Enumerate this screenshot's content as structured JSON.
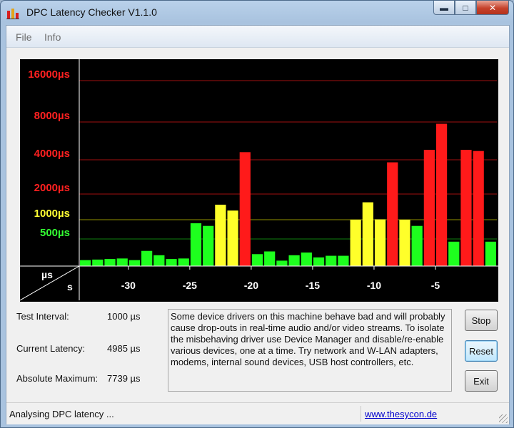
{
  "window": {
    "title": "DPC Latency Checker V1.1.0",
    "controls": {
      "minimize": "▬",
      "maximize": "□",
      "close": "✕"
    }
  },
  "menu": [
    {
      "label": "File"
    },
    {
      "label": "Info"
    }
  ],
  "chart_data": {
    "type": "bar",
    "x_unit_label": "s",
    "y_unit_label": "µs",
    "x_ticks": [
      -30,
      -25,
      -20,
      -15,
      -10,
      -5
    ],
    "x_range": [
      -34,
      0
    ],
    "y_levels": [
      {
        "label": "16000µs",
        "value": 16000,
        "color": "#ff2020",
        "grid_color": "#a01010"
      },
      {
        "label": "8000µs",
        "value": 8000,
        "color": "#ff2020",
        "grid_color": "#a01010"
      },
      {
        "label": "4000µs",
        "value": 4000,
        "color": "#ff2020",
        "grid_color": "#a01010"
      },
      {
        "label": "2000µs",
        "value": 2000,
        "color": "#ff2020",
        "grid_color": "#a01010"
      },
      {
        "label": "1000µs",
        "value": 1000,
        "color": "#ffff33",
        "grid_color": "#909000"
      },
      {
        "label": "500µs",
        "value": 500,
        "color": "#33ff33",
        "grid_color": "#108010"
      }
    ],
    "thresholds": {
      "yellow_from": 1000,
      "red_from": 2000
    },
    "colors": {
      "green": "#1eff1e",
      "yellow": "#ffff2a",
      "red": "#ff1a1a"
    },
    "values": [
      110,
      120,
      130,
      140,
      110,
      280,
      200,
      130,
      140,
      880,
      800,
      1500,
      1280,
      4600,
      220,
      270,
      100,
      200,
      250,
      160,
      190,
      190,
      1000,
      1600,
      1010,
      3800,
      1000,
      800,
      4800,
      7739,
      450,
      4800,
      4700,
      450
    ]
  },
  "stats": {
    "test_interval": {
      "label": "Test Interval:",
      "value": "1000 µs"
    },
    "current_latency": {
      "label": "Current Latency:",
      "value": "4985 µs"
    },
    "absolute_maximum": {
      "label": "Absolute Maximum:",
      "value": "7739 µs"
    }
  },
  "message": "Some device drivers on this machine behave bad and will probably cause drop-outs in real-time audio and/or video streams. To isolate the misbehaving driver use Device Manager and disable/re-enable various devices, one at a time. Try network and W-LAN adapters, modems, internal sound devices, USB host controllers, etc.",
  "buttons": {
    "stop": "Stop",
    "reset": "Reset",
    "exit": "Exit"
  },
  "status": {
    "text": "Analysing DPC latency ...",
    "link": "www.thesycon.de"
  }
}
